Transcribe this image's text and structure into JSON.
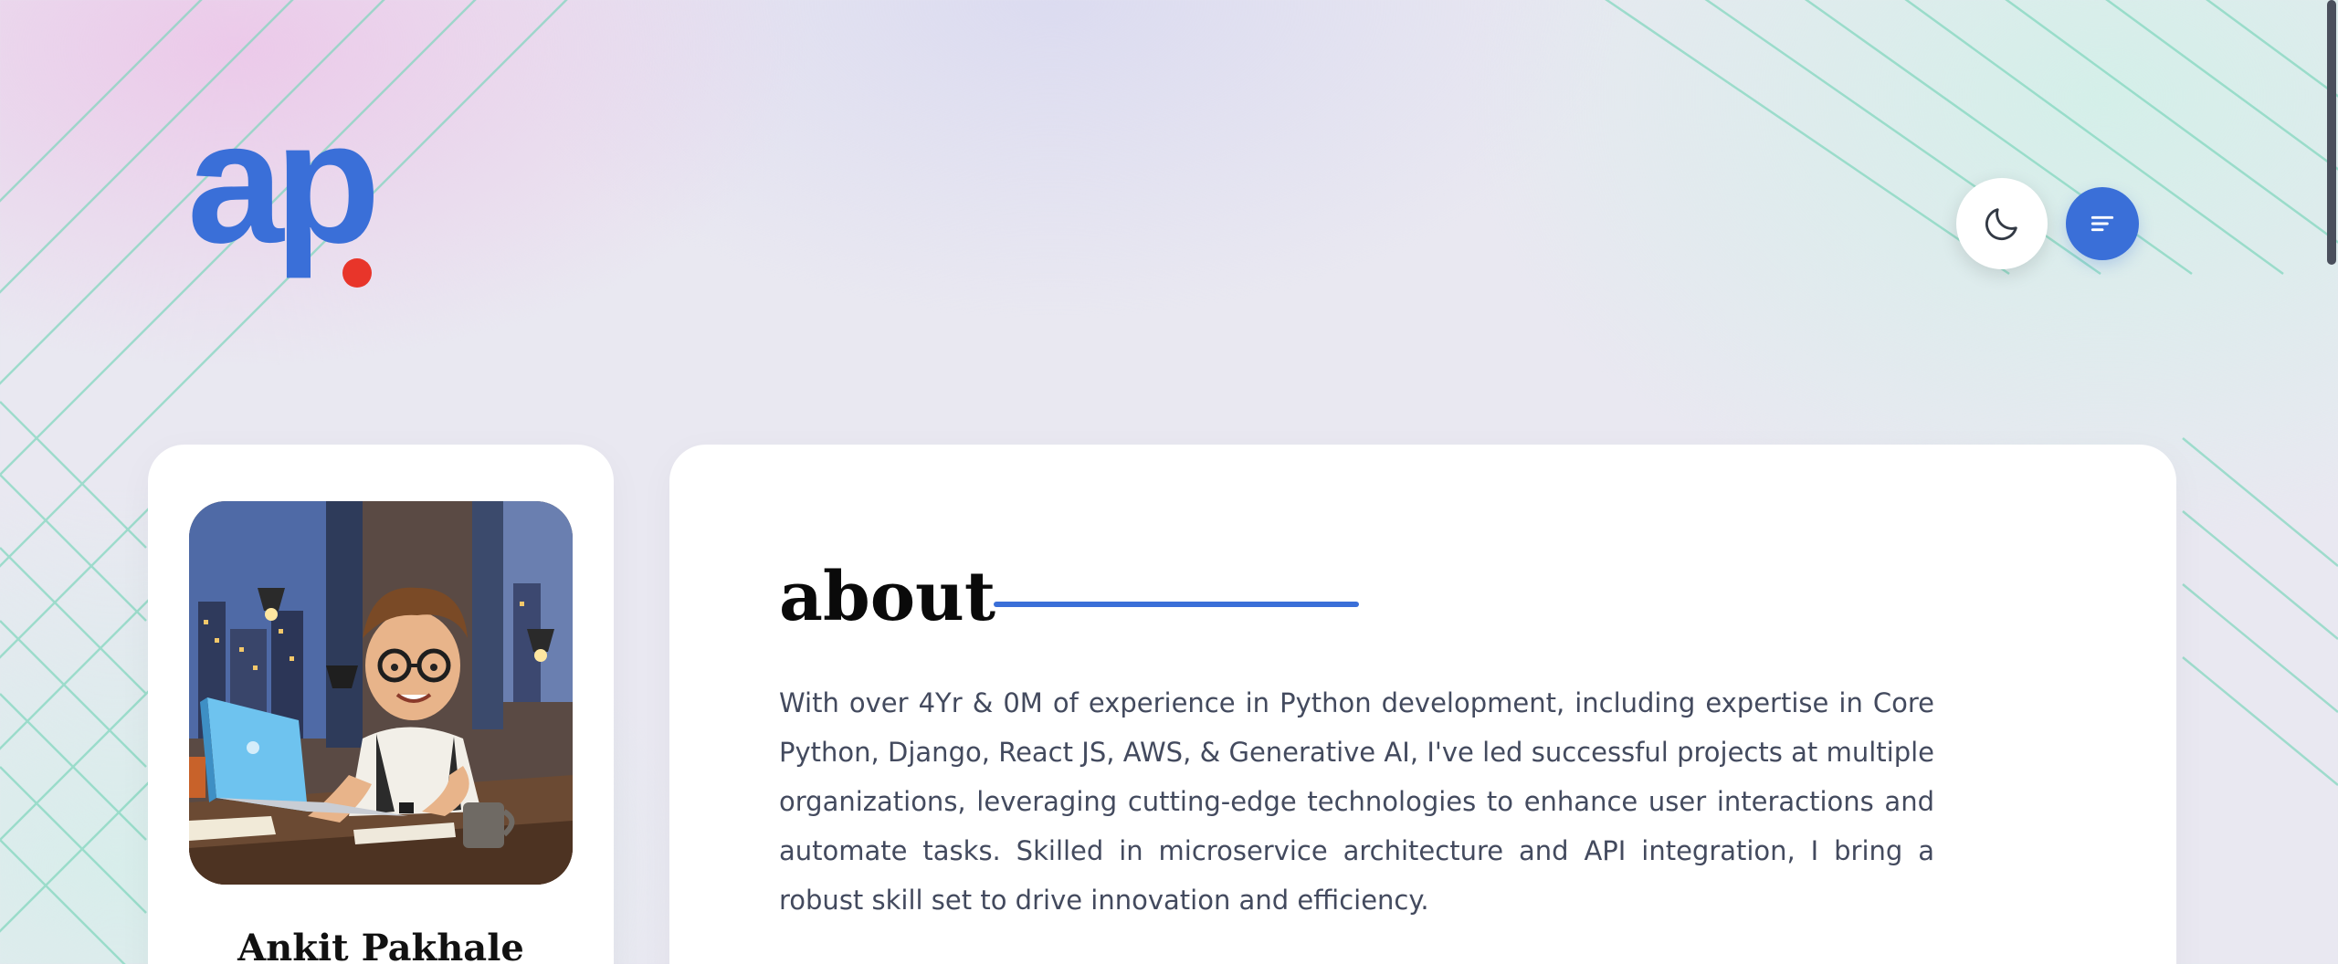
{
  "header": {
    "logo_text": "ap",
    "theme_toggle_icon": "moon-icon",
    "menu_icon": "menu-lines-icon"
  },
  "colors": {
    "accent": "#3a6fd8",
    "logo_dot": "#e8352a",
    "heading": "#0a0a0a",
    "body_text": "#434a5e"
  },
  "profile": {
    "name": "Ankit Pakhale",
    "avatar": "developer-avatar-illustration"
  },
  "about": {
    "title": "about",
    "text": "With over 4Yr & 0M of experience in Python development, including expertise in Core Python, Django, React JS, AWS, & Generative AI, I've led successful projects at multiple organizations, leveraging cutting-edge technologies to enhance user interactions and automate tasks. Skilled in microservice architecture and API integration, I bring a robust skill set to drive innovation and efficiency."
  }
}
